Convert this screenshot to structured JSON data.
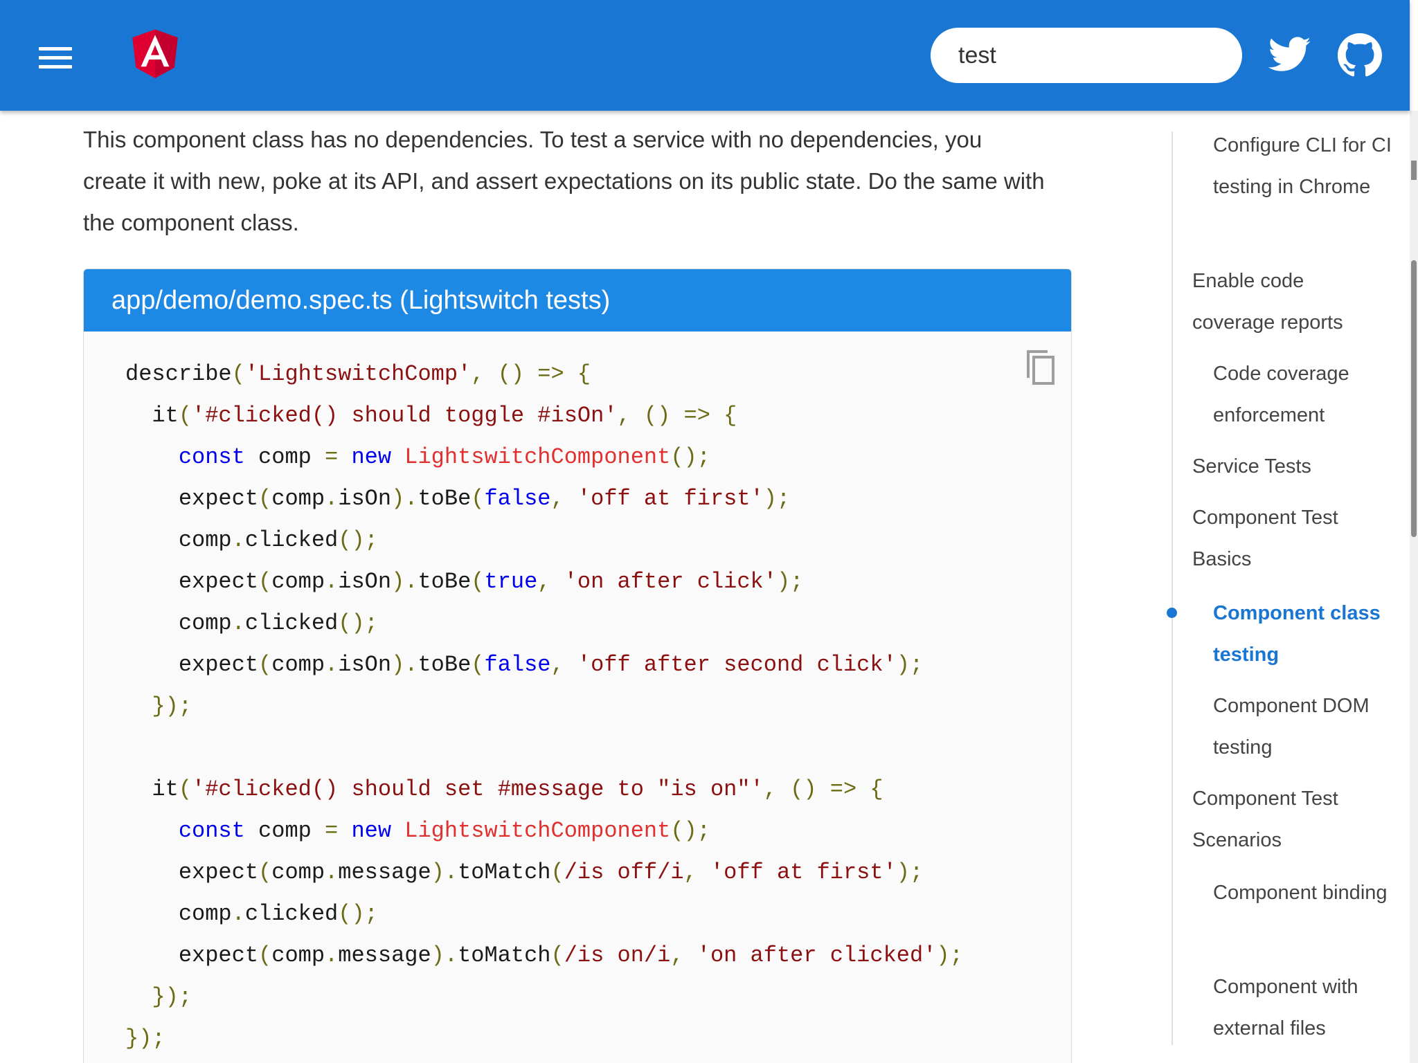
{
  "header": {
    "search_value": "test",
    "colors": {
      "bar": "#1976d2",
      "accent": "#1e88e5",
      "logo_red": "#dd0031",
      "logo_dark": "#c3002f"
    },
    "icons": [
      "menu-icon",
      "angular-logo",
      "twitter-icon",
      "github-icon"
    ]
  },
  "intro": {
    "part1": "This component class has no dependencies. To test a service with no dependencies, you create it with ",
    "code": "new",
    "part2": ", poke at its API, and assert expectations on its public state. Do the same with the component class."
  },
  "code_example": {
    "title": "app/demo/demo.spec.ts (Lightswitch tests)",
    "lines": [
      "describe('LightswitchComp', () => {",
      "  it('#clicked() should toggle #isOn', () => {",
      "    const comp = new LightswitchComponent();",
      "    expect(comp.isOn).toBe(false, 'off at first');",
      "    comp.clicked();",
      "    expect(comp.isOn).toBe(true, 'on after click');",
      "    comp.clicked();",
      "    expect(comp.isOn).toBe(false, 'off after second click');",
      "  });",
      "",
      "  it('#clicked() should set #message to \"is on\"', () => {",
      "    const comp = new LightswitchComponent();",
      "    expect(comp.message).toMatch(/is off/i, 'off at first');",
      "    comp.clicked();",
      "    expect(comp.message).toMatch(/is on/i, 'on after clicked');",
      "  });",
      "});"
    ]
  },
  "toc": {
    "items": [
      {
        "label": "Configure CLI for CI testing in Chrome",
        "level": 3,
        "active": false
      },
      {
        "label": "Enable code coverage reports",
        "level": 2,
        "active": false
      },
      {
        "label": "Code coverage enforcement",
        "level": 3,
        "active": false
      },
      {
        "label": "Service Tests",
        "level": 2,
        "active": false
      },
      {
        "label": "Component Test Basics",
        "level": 2,
        "active": false
      },
      {
        "label": "Component class testing",
        "level": 3,
        "active": true
      },
      {
        "label": "Component DOM testing",
        "level": 3,
        "active": false
      },
      {
        "label": "Component Test Scenarios",
        "level": 2,
        "active": false
      },
      {
        "label": "Component binding",
        "level": 3,
        "active": false
      },
      {
        "label": "Component with external files",
        "level": 3,
        "active": false
      }
    ]
  }
}
